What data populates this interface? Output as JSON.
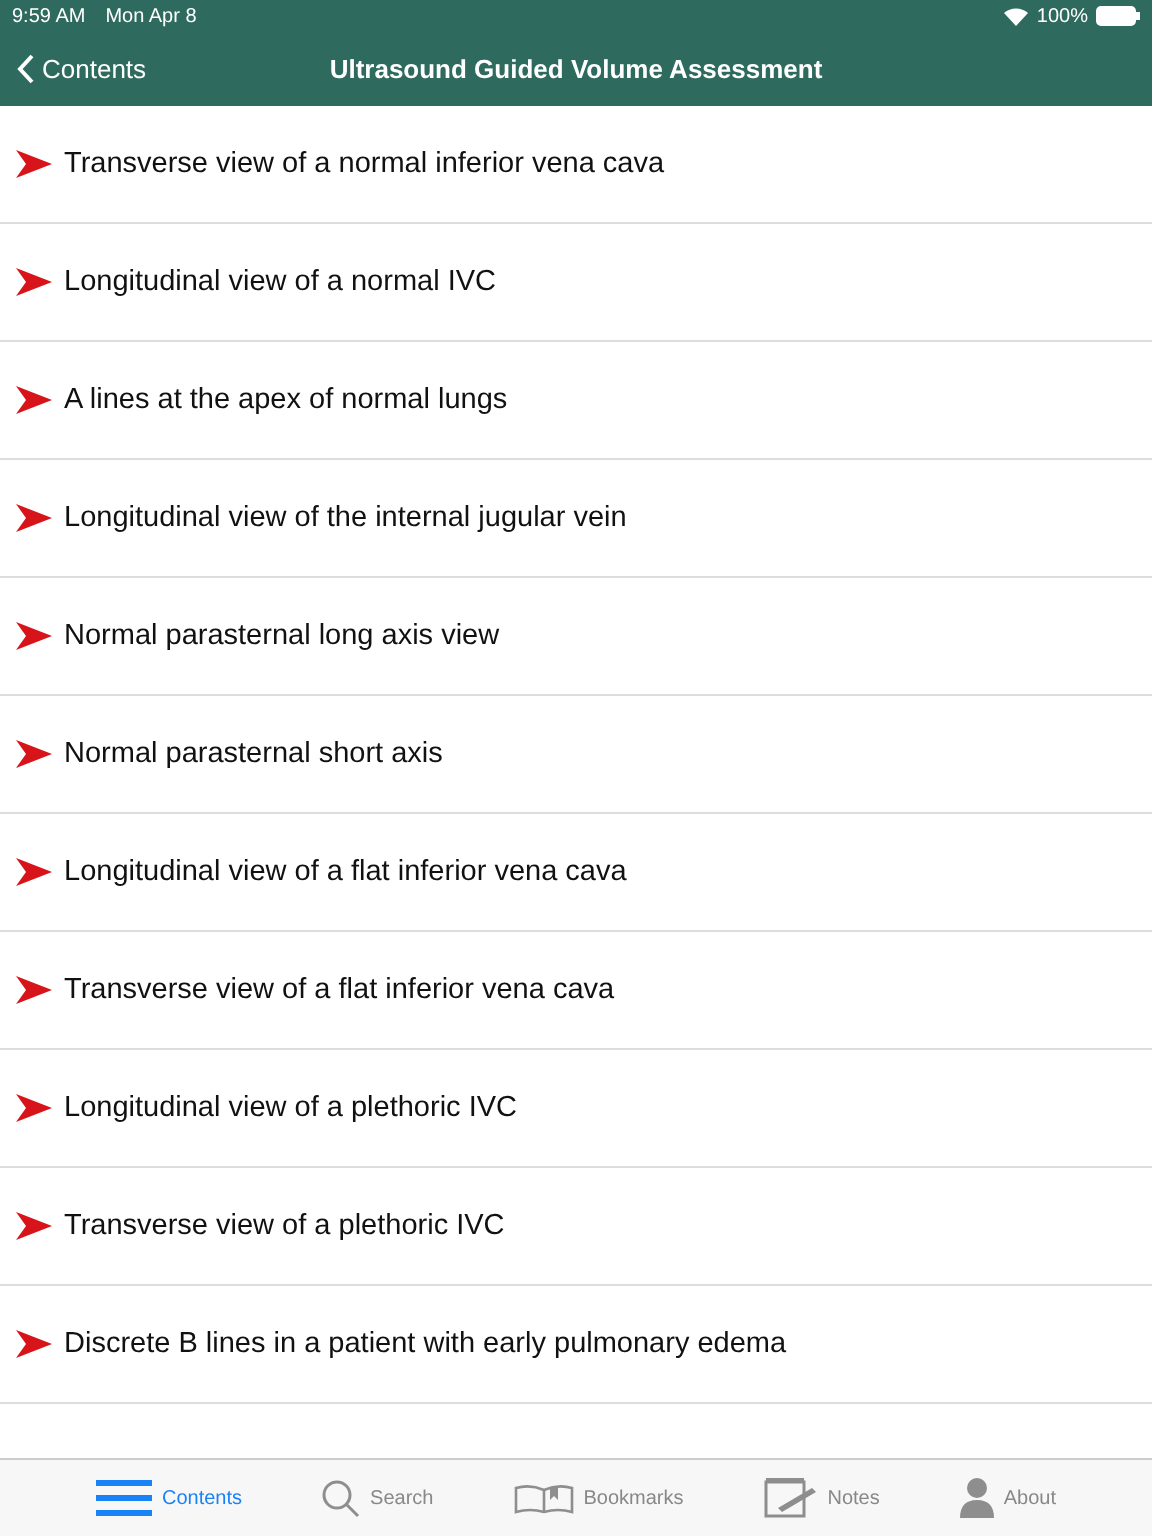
{
  "status_bar": {
    "time": "9:59 AM",
    "date": "Mon Apr 8",
    "battery": "100%"
  },
  "nav_bar": {
    "back": "Contents",
    "title": "Ultrasound Guided Volume Assessment"
  },
  "items": [
    {
      "label": "Transverse view of a normal inferior vena cava"
    },
    {
      "label": "Longitudinal view of a normal IVC"
    },
    {
      "label": "A lines at the apex of normal lungs"
    },
    {
      "label": "Longitudinal view of the internal jugular vein"
    },
    {
      "label": "Normal parasternal long axis view"
    },
    {
      "label": "Normal parasternal short axis"
    },
    {
      "label": "Longitudinal view of a flat inferior vena cava"
    },
    {
      "label": "Transverse view of a flat inferior vena cava"
    },
    {
      "label": "Longitudinal view of a plethoric IVC"
    },
    {
      "label": "Transverse view of a plethoric IVC"
    },
    {
      "label": "Discrete B lines in a patient with early pulmonary edema"
    }
  ],
  "tab_bar": [
    {
      "label": "Contents",
      "kind": "contents",
      "selected": true
    },
    {
      "label": "Search",
      "kind": "search",
      "selected": false
    },
    {
      "label": "Bookmarks",
      "kind": "bookmarks",
      "selected": false
    },
    {
      "label": "Notes",
      "kind": "notes",
      "selected": false
    },
    {
      "label": "About",
      "kind": "about",
      "selected": false
    }
  ]
}
